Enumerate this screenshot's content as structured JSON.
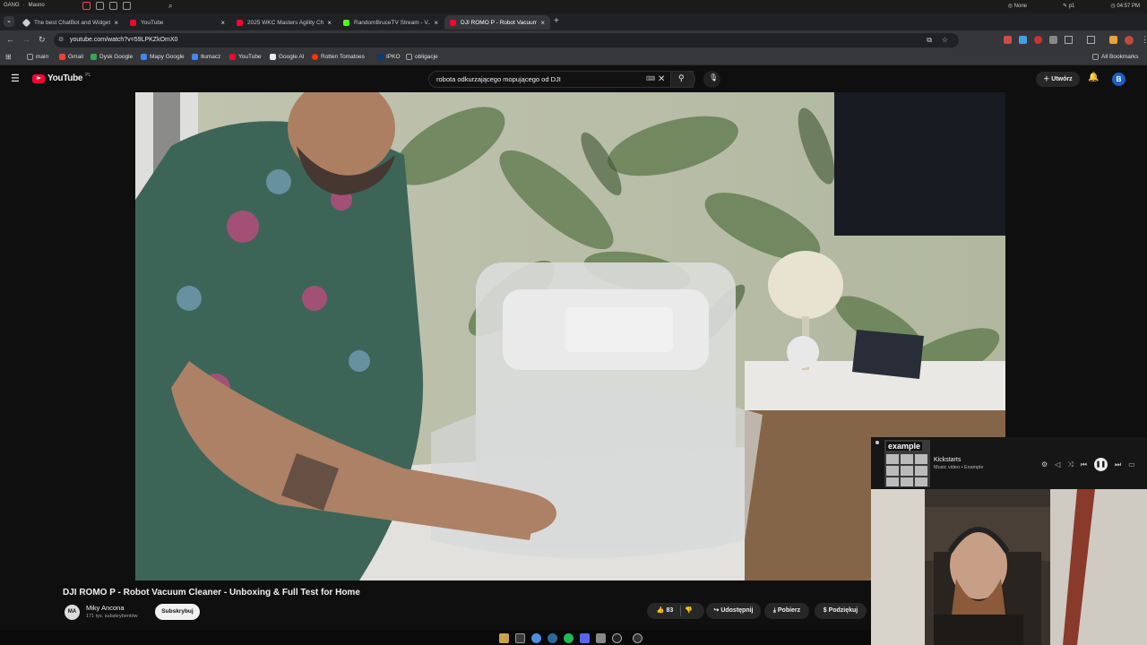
{
  "os_bar": {
    "workspace": "GANG",
    "user": "Masno",
    "status1": "None",
    "status2": "p1",
    "clock": "04:57 PM"
  },
  "browser": {
    "tabs": [
      {
        "title": "The best ChatBot and Widgets",
        "favicon_color": "#cfcfcf"
      },
      {
        "title": "YouTube",
        "favicon_color": "#ff0033"
      },
      {
        "title": "2025 WKC Masters Agility Ch...",
        "favicon_color": "#ff0033"
      },
      {
        "title": "RandomBruceTV Stream - V...",
        "favicon_color": "#53fc18"
      },
      {
        "title": "DJI ROMO P - Robot Vacuum...",
        "favicon_color": "#ff0033"
      }
    ],
    "url": "youtube.com/watch?v=59LPKZkOmX0",
    "bookmarks": [
      {
        "label": "main",
        "icon_color": "#9aa0a6"
      },
      {
        "label": "Gmail",
        "icon_color": "#ea4335"
      },
      {
        "label": "Dysk Google",
        "icon_color": "#34a853"
      },
      {
        "label": "Mapy Google",
        "icon_color": "#4285f4"
      },
      {
        "label": "tłumacz",
        "icon_color": "#4285f4"
      },
      {
        "label": "YouTube",
        "icon_color": "#ff0033"
      },
      {
        "label": "Google AI",
        "icon_color": "#e8eaed"
      },
      {
        "label": "Rotten Tomatoes",
        "icon_color": "#fa320a"
      },
      {
        "label": "IPKO",
        "icon_color": "#0a3a7a"
      },
      {
        "label": "obligacje",
        "icon_color": "#9aa0a6"
      }
    ],
    "all_bookmarks": "All Bookmarks"
  },
  "youtube": {
    "logo_text": "YouTube",
    "logo_region": "PL",
    "search_query": "robota odkurzającego mopującego od DJI",
    "create_label": "Utwórz",
    "avatar_letter": "B"
  },
  "video": {
    "title": "DJI ROMO P - Robot Vacuum Cleaner - Unboxing & Full Test for Home",
    "channel": "Miky Ancona",
    "channel_initials": "MA",
    "subscribers": "171 tys. subskrybentów",
    "subscribe_label": "Subskrybuj",
    "likes": "83",
    "share_label": "Udostępnij",
    "download_label": "Pobierz",
    "thanks_label": "Podziękuj"
  },
  "media_player": {
    "album_brand": "example",
    "track": "Kickstarts",
    "meta": "Music video • Example"
  },
  "taskbar": {
    "icons": [
      "files-icon",
      "terminal-icon",
      "chrome-icon",
      "steam-icon",
      "spotify-icon",
      "discord-icon",
      "shield-icon",
      "obs-icon",
      "app-icon"
    ]
  }
}
